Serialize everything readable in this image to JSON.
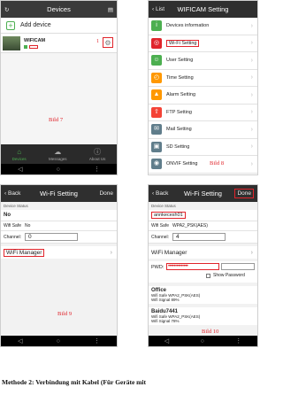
{
  "panel1": {
    "title": "Devices",
    "add_device": "Add device",
    "device_name": "WIFICAM",
    "marker": "1",
    "tabs": [
      {
        "label": "Devices",
        "icon": "home-icon"
      },
      {
        "label": "Messages",
        "icon": "cloud-icon"
      },
      {
        "label": "About Us",
        "icon": "info-icon"
      }
    ],
    "caption": "Bild 7"
  },
  "panel2": {
    "back": "List",
    "title": "WIFICAM Setting",
    "items": [
      {
        "label": "Devices information",
        "icon": "info-icon",
        "color": "#4caf50"
      },
      {
        "label": "Wi-Fi Setting",
        "icon": "wifi-icon",
        "color": "#e0242b"
      },
      {
        "label": "User Setting",
        "icon": "user-icon",
        "color": "#4caf50"
      },
      {
        "label": "Time Setting",
        "icon": "clock-icon",
        "color": "#ff9800"
      },
      {
        "label": "Alarm Setting",
        "icon": "alarm-icon",
        "color": "#ff9800"
      },
      {
        "label": "FTP Setting",
        "icon": "upload-icon",
        "color": "#f44336"
      },
      {
        "label": "Mail Setting",
        "icon": "mail-icon",
        "color": "#607d8b"
      },
      {
        "label": "SD Setting",
        "icon": "sd-card-icon",
        "color": "#607d8b"
      },
      {
        "label": "ONVIF Setting",
        "icon": "camera-icon",
        "color": "#607d8b"
      },
      {
        "label": "DDNS Setting",
        "icon": "globe-icon",
        "color": "#3f51b5"
      }
    ],
    "caption": "Bild 8"
  },
  "panel3": {
    "back": "Back",
    "title": "Wi-Fi Setting",
    "done": "Done",
    "status_label": "Device Status",
    "status_value": "No",
    "wifi_safe_label": "Wifi Safe",
    "wifi_safe_value": "No",
    "channel_label": "Channel:",
    "channel_value": "0",
    "wifi_manager": "WiFi Manager",
    "caption": "Bild 9"
  },
  "panel4": {
    "back": "Back",
    "title": "Wi-Fi Setting",
    "done": "Done",
    "status_label": "Device Status",
    "ssid": "annkecesh01",
    "wifi_safe_label": "Wifi Safe",
    "wifi_safe_value": "WPA2_PSK(AES)",
    "channel_label": "Channel:",
    "channel_value": "4",
    "wifi_manager": "WiFi Manager",
    "pwd_label": "PWD:",
    "pwd_value": "••••••••••••••",
    "show_password": "Show Password",
    "networks": [
      {
        "name": "Office",
        "safe_label": "Wifi Safe",
        "safe": "WPA2_PSK(AES)",
        "signal_label": "Wifi Signal",
        "signal": "89%"
      },
      {
        "name": "Baidu7441",
        "safe_label": "Wifi Safe",
        "safe": "WPA2_PSK(AES)",
        "signal_label": "Wifi Signal",
        "signal": "78%"
      }
    ],
    "caption": "Bild 10"
  },
  "page_caption": "Methode 2: Verbindung mit Kabel (Für Geräte mit"
}
